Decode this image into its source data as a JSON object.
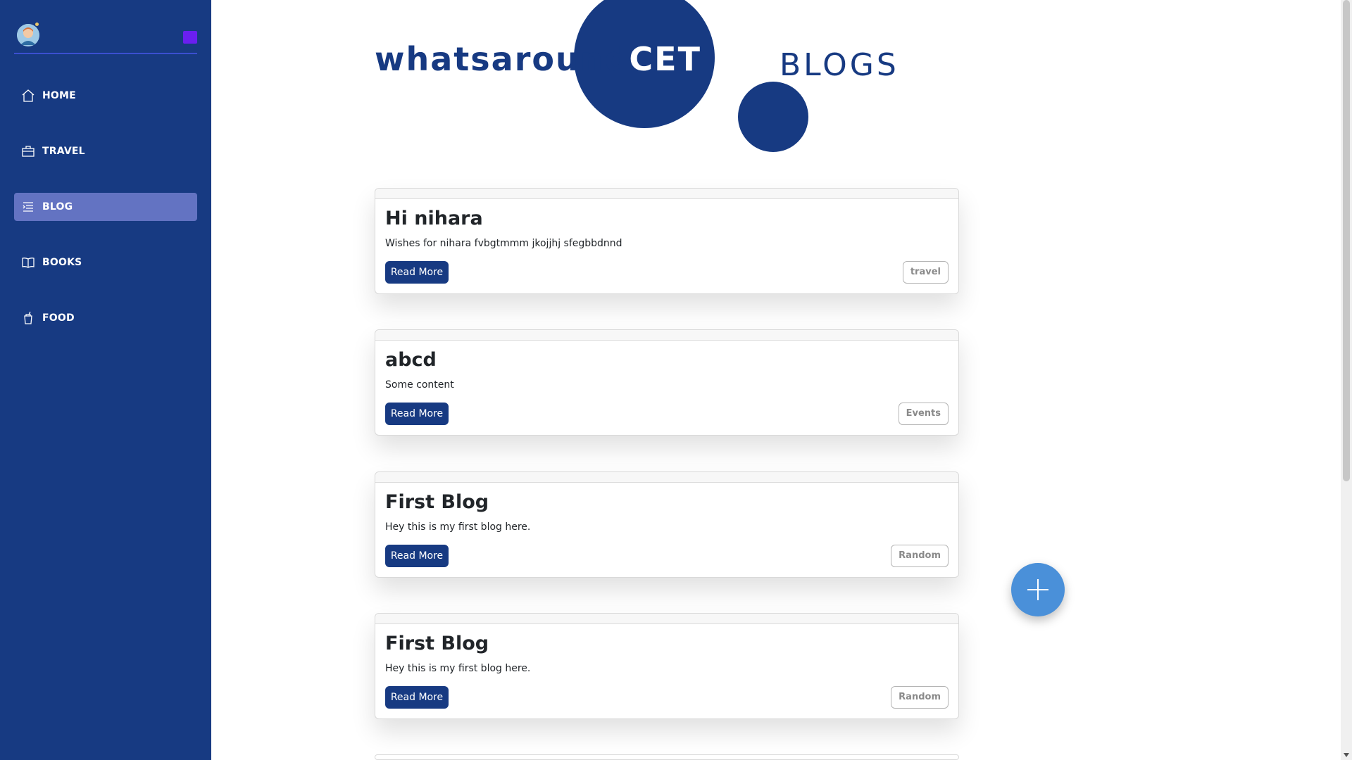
{
  "colors": {
    "sidebar_bg": "#173a82",
    "active_item_bg": "#6373c2",
    "accent": "#173a82",
    "fab": "#4a90d9"
  },
  "sidebar": {
    "avatar_icon": "user-avatar",
    "collapse_icon": "collapse-toggle-icon",
    "items": [
      {
        "label": "HOME",
        "icon": "home-icon",
        "active": false
      },
      {
        "label": "TRAVEL",
        "icon": "briefcase-icon",
        "active": false
      },
      {
        "label": "BLOG",
        "icon": "list-icon",
        "active": true
      },
      {
        "label": "BOOKS",
        "icon": "book-icon",
        "active": false
      },
      {
        "label": "FOOD",
        "icon": "cup-icon",
        "active": false
      }
    ]
  },
  "header": {
    "brand_prefix": "whatsaround",
    "brand_suffix": "CET",
    "page_title": "BLOGS"
  },
  "posts": [
    {
      "title": "Hi nihara",
      "text": "Wishes for nihara fvbgtmmm jkojjhj sfegbbdnnd",
      "button": "Read More",
      "tag": "travel"
    },
    {
      "title": "abcd",
      "text": "Some content",
      "button": "Read More",
      "tag": "Events"
    },
    {
      "title": "First Blog",
      "text": "Hey this is my first blog here.",
      "button": "Read More",
      "tag": "Random"
    },
    {
      "title": "First Blog",
      "text": "Hey this is my first blog here.",
      "button": "Read More",
      "tag": "Random"
    }
  ],
  "fab": {
    "icon": "plus-icon"
  }
}
